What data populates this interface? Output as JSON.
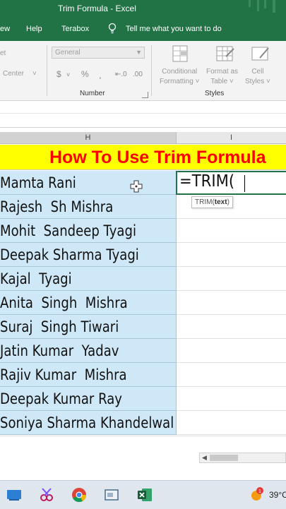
{
  "window": {
    "title": "Trim Formula  -  Excel"
  },
  "ribbon_tabs": [
    "ew",
    "Help",
    "Terabox"
  ],
  "tell_me": "Tell me what you want to do",
  "ribbon": {
    "align_label": "et",
    "center_label": "Center",
    "number_format": "General",
    "currency_symbol": "$",
    "percent_symbol": "%",
    "comma_symbol": "¸",
    "increase_decimal": "⇤.0",
    "decrease_decimal": ".00",
    "number_group": "Number",
    "styles_group": "Styles",
    "conditional_formatting": [
      "Conditional",
      "Formatting ˅"
    ],
    "format_as_table": [
      "Format as",
      "Table ˅"
    ],
    "cell_styles": [
      "Cell",
      "Styles ˅"
    ]
  },
  "columns": [
    "H",
    "I"
  ],
  "banner": "How To Use Trim Formula",
  "names": [
    "Mamta Rani",
    "Rajesh  Sh Mishra",
    "Mohit  Sandeep Tyagi",
    "Deepak Sharma Tyagi",
    "Kajal  Tyagi",
    "Anita  Singh  Mishra",
    "Suraj  Singh Tiwari",
    "Jatin Kumar  Yadav",
    "Rajiv Kumar  Mishra",
    "Deepak Kumar Ray",
    "Soniya Sharma Khandelwal"
  ],
  "formula_input": "=TRIM(",
  "tooltip": {
    "func": "TRIM(",
    "arg": "text",
    "close": ")"
  },
  "taskbar": {
    "temperature": "39°C",
    "notification_count": "1"
  },
  "colors": {
    "excel_green": "#217346",
    "banner_bg": "#ffff00",
    "banner_text": "#ff0000",
    "name_cell_bg": "#cfe8f7"
  }
}
